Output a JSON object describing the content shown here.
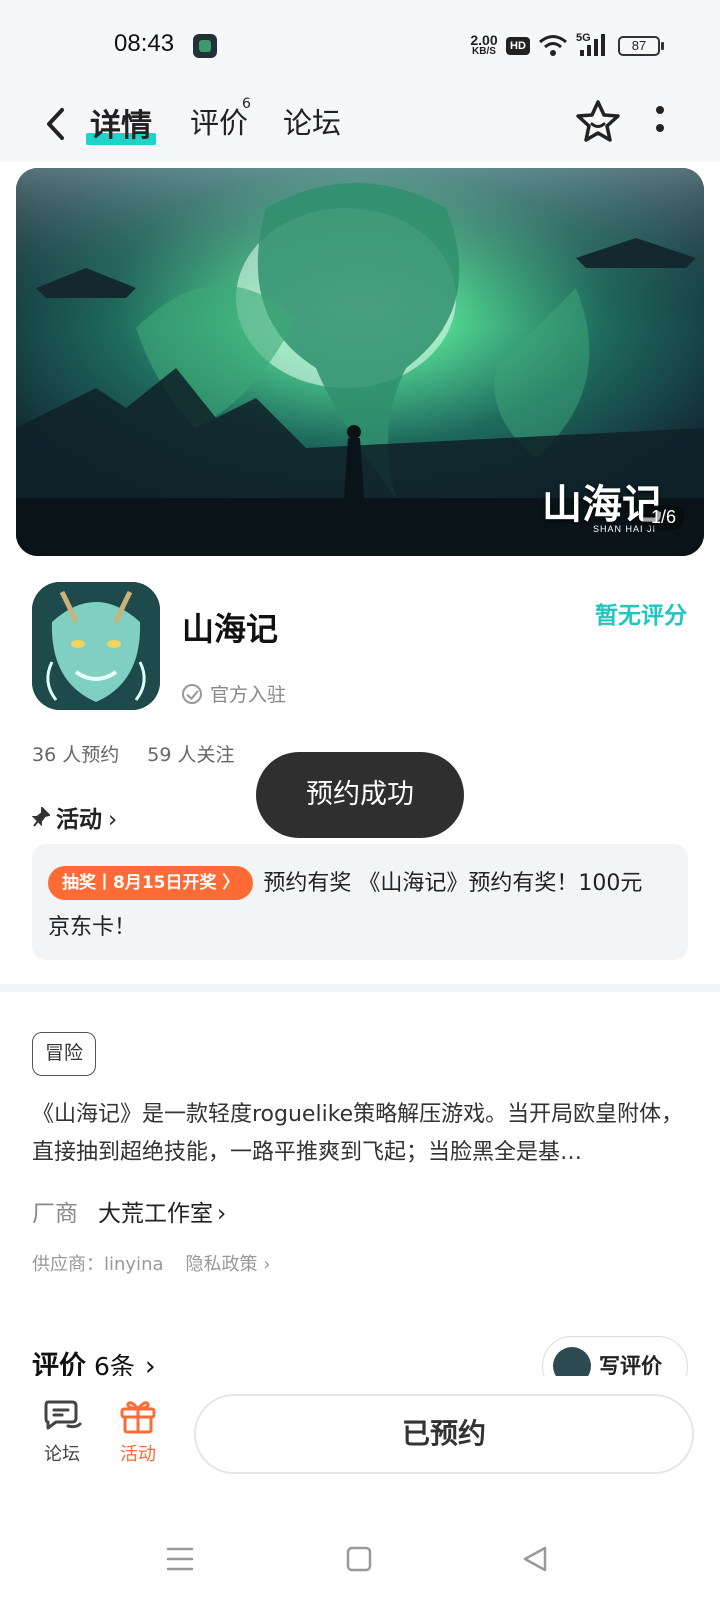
{
  "status_bar": {
    "time": "08:43",
    "net_speed_value": "2.00",
    "net_speed_unit": "KB/S",
    "hd_label": "HD",
    "network_label": "5G",
    "battery": "87"
  },
  "header": {
    "tabs": [
      {
        "label": "详情",
        "active": true
      },
      {
        "label": "评价",
        "badge": "6"
      },
      {
        "label": "论坛"
      }
    ]
  },
  "banner": {
    "logo_text": "山海记",
    "logo_sub": "SHAN HAI JI",
    "counter": "1/6"
  },
  "app": {
    "name": "山海记",
    "official_label": "官方入驻",
    "rating_label": "暂无评分",
    "reservations": "36 人预约",
    "followers": "59 人关注"
  },
  "activity": {
    "heading": "活动",
    "promo_badge": "抽奖丨8月15日开奖 〉",
    "promo_text": "预约有奖 《山海记》预约有奖！100元京东卡！"
  },
  "toast": {
    "text": "预约成功"
  },
  "detail": {
    "tag": "冒险",
    "description": "《山海记》是一款轻度roguelike策略解压游戏。当开局欧皇附体，直接抽到超绝技能，一路平推爽到飞起；当脸黑全是基…",
    "vendor_label": "厂商",
    "vendor_name": "大荒工作室",
    "supplier": "供应商：linyina",
    "privacy": "隐私政策"
  },
  "reviews": {
    "heading": "评价",
    "count": "6条",
    "write_label": "写评价"
  },
  "bottom_bar": {
    "forum_label": "论坛",
    "activity_label": "活动",
    "reserved_label": "已预约"
  },
  "colors": {
    "accent_teal": "#1ed3c8",
    "accent_orange": "#ff6b35",
    "toast_bg": "#2f2f2f"
  }
}
